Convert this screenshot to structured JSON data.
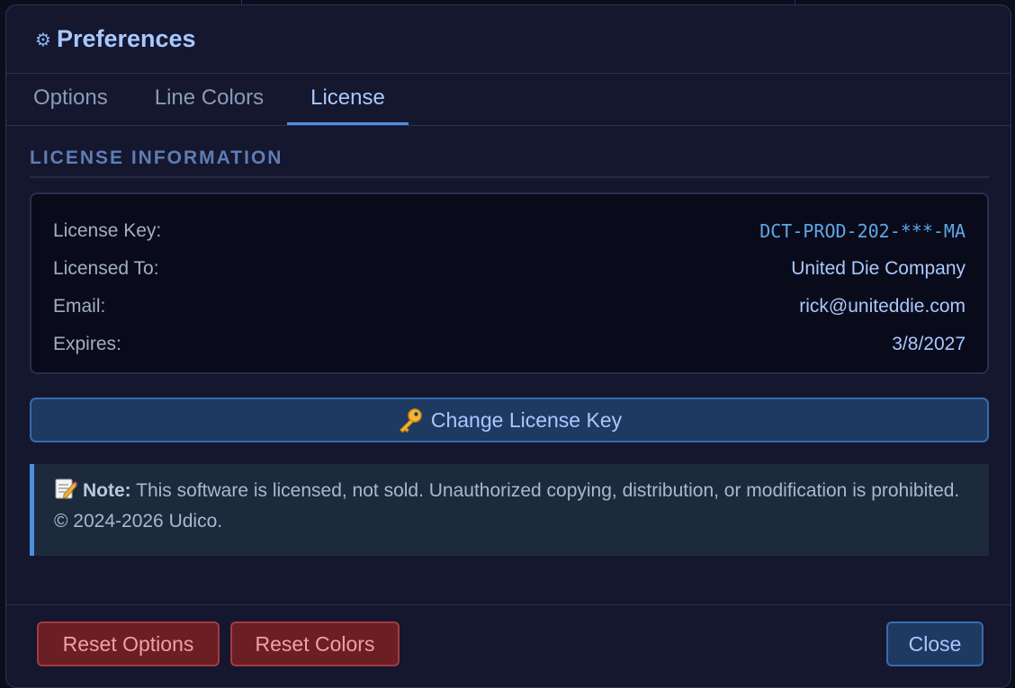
{
  "dialog": {
    "title": "Preferences",
    "title_icon": "gear-icon"
  },
  "tabs": [
    {
      "label": "Options",
      "active": false
    },
    {
      "label": "Line Colors",
      "active": false
    },
    {
      "label": "License",
      "active": true
    }
  ],
  "license": {
    "section_title": "LICENSE INFORMATION",
    "rows": [
      {
        "label": "License Key:",
        "value": "DCT-PROD-202-***-MA"
      },
      {
        "label": "Licensed To:",
        "value": "United Die Company"
      },
      {
        "label": "Email:",
        "value": "rick@uniteddie.com"
      },
      {
        "label": "Expires:",
        "value": "3/8/2027"
      }
    ],
    "change_button_label": "Change License Key",
    "change_button_icon": "key-icon"
  },
  "note": {
    "icon": "memo-icon",
    "heading": "Note:",
    "text": " This software is licensed, not sold. Unauthorized copying, distribution, or modification is prohibited. © 2024-2026 Udico."
  },
  "footer": {
    "reset_options_label": "Reset Options",
    "reset_colors_label": "Reset Colors",
    "close_label": "Close"
  },
  "colors": {
    "accent": "#4d8fe0",
    "danger": "#a33a42",
    "background": "#14172e"
  }
}
